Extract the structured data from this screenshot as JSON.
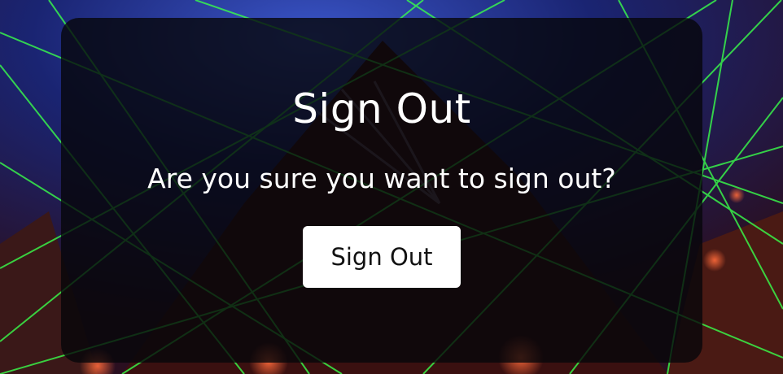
{
  "dialog": {
    "title": "Sign Out",
    "message": "Are you sure you want to sign out?",
    "button_label": "Sign Out"
  },
  "colors": {
    "card_background": "#06060a",
    "text": "#ffffff",
    "button_background": "#ffffff",
    "button_text": "#111111",
    "laser_green": "#39ff4a"
  }
}
